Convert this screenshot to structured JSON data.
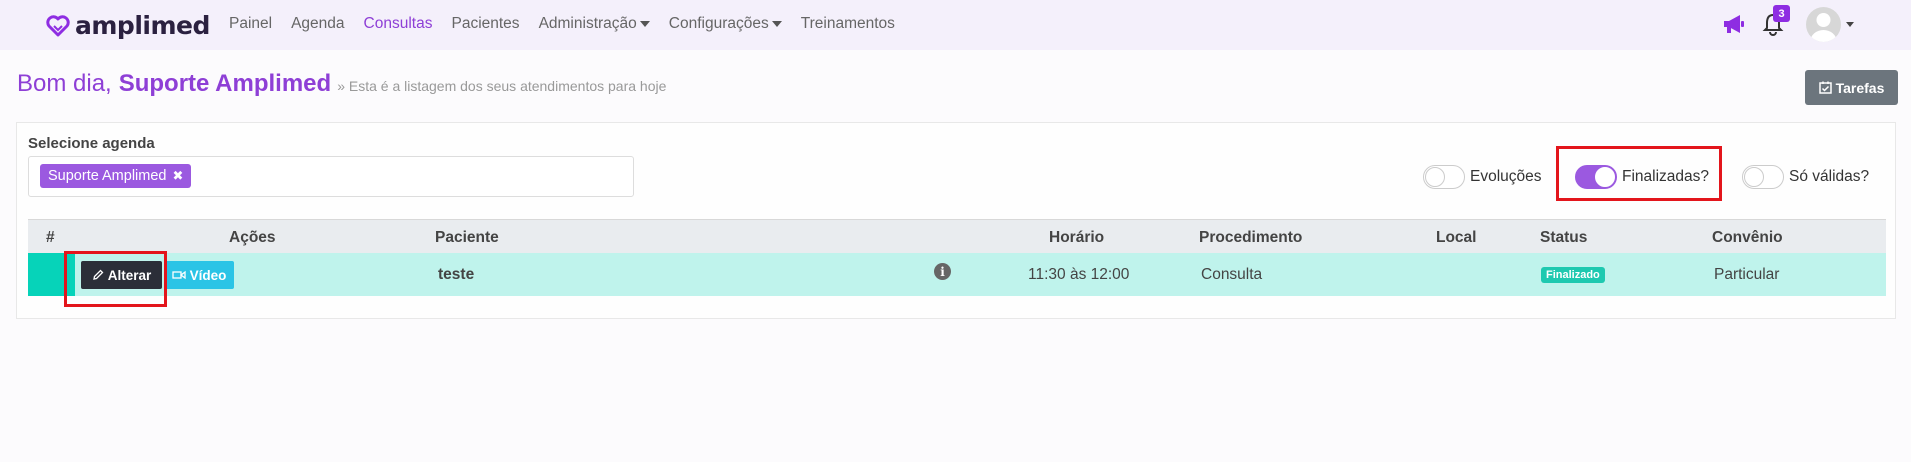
{
  "navbar": {
    "brand": "amplimed",
    "items": [
      {
        "label": "Painel",
        "active": false,
        "dropdown": false
      },
      {
        "label": "Agenda",
        "active": false,
        "dropdown": false
      },
      {
        "label": "Consultas",
        "active": true,
        "dropdown": false
      },
      {
        "label": "Pacientes",
        "active": false,
        "dropdown": false
      },
      {
        "label": "Administração",
        "active": false,
        "dropdown": true
      },
      {
        "label": "Configurações",
        "active": false,
        "dropdown": true
      },
      {
        "label": "Treinamentos",
        "active": false,
        "dropdown": false
      }
    ],
    "notification_count": "3",
    "icons": [
      "megaphone-icon",
      "bell-icon",
      "user-avatar"
    ]
  },
  "header": {
    "greeting": "Bom dia,",
    "user_name": "Suporte Amplimed",
    "subtitle": "» Esta é a listagem dos seus atendimentos para hoje",
    "tasks_button": "Tarefas"
  },
  "filters": {
    "select_label": "Selecione agenda",
    "selected_agenda": "Suporte Amplimed",
    "toggles": [
      {
        "label": "Evoluções",
        "on": false
      },
      {
        "label": "Finalizadas?",
        "on": true
      },
      {
        "label": "Só válidas?",
        "on": false
      }
    ]
  },
  "table": {
    "columns": [
      "#",
      "Ações",
      "Paciente",
      "Horário",
      "Procedimento",
      "Local",
      "Status",
      "Convênio"
    ],
    "rows": [
      {
        "actions": {
          "edit": "Alterar",
          "video": "Vídeo"
        },
        "patient": "teste",
        "time": "11:30 às 12:00",
        "procedure": "Consulta",
        "location": "",
        "status": "Finalizado",
        "insurance": "Particular"
      }
    ]
  },
  "colors": {
    "brand_purple": "#8e3fd6",
    "row_highlight": "#bff3ec",
    "row_stripe": "#06d3b9",
    "status_finished": "#1ec9b0",
    "highlight_box": "#e3151c"
  }
}
